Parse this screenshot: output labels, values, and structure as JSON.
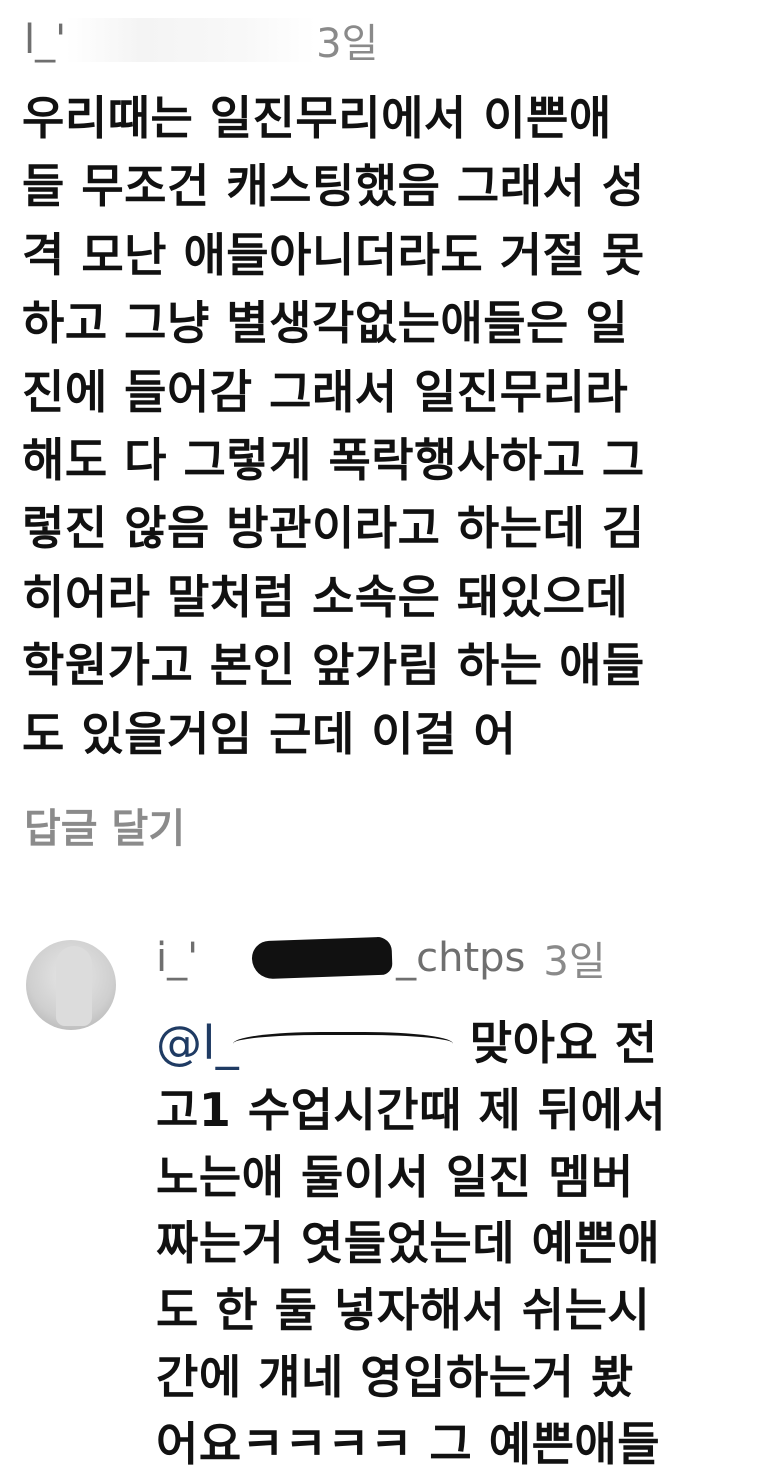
{
  "comment": {
    "username": "l_'",
    "time": "3일",
    "lines": [
      "우리때는 일진무리에서 이쁜애",
      "들 무조건 캐스팅했음 그래서 성",
      "격 모난 애들아니더라도 거절 못",
      "하고 그냥 별생각없는애들은 일",
      "진에 들어감  그래서 일진무리라",
      "해도 다 그렇게 폭락행사하고 그",
      "렇진 않음 방관이라고 하는데 김",
      "히어라 말처럼 소속은 돼있으데",
      "학원가고 본인 앞가림 하는 애들",
      "도 있을거임 근데 이걸 어"
    ],
    "reply_label": "답글 달기"
  },
  "reply": {
    "username_prefix": "i_'",
    "username_suffix": "_chtps",
    "time": "3일",
    "mention": "@l_",
    "first_line_text": "맞아요 전",
    "lines": [
      "고1 수업시간때 제 뒤에서",
      "노는애 둘이서 일진 멤버",
      "짜는거 엿들었는데 예쁜애",
      "도 한 둘 넣자해서 쉬는시",
      "간에 걔네 영입하는거 봤",
      "어요ㅋㅋㅋㅋ 그 예쁜애들"
    ]
  },
  "colors": {
    "text": "#111111",
    "meta": "#8a8a8a",
    "mention": "#1f3b63",
    "background": "#ffffff"
  }
}
